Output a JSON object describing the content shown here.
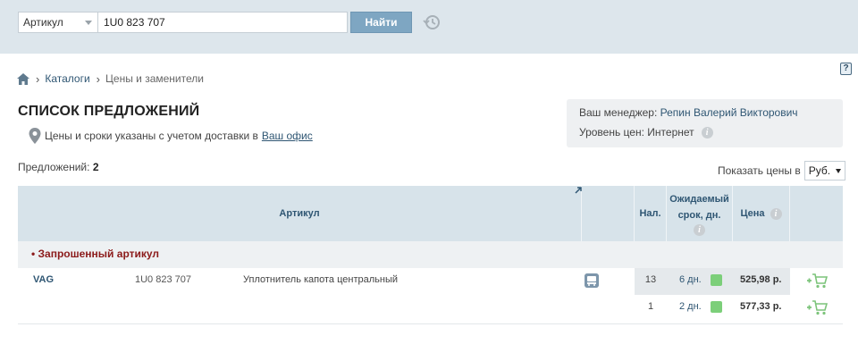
{
  "search": {
    "type_label": "Артикул",
    "query": "1U0 823 707",
    "button_label": "Найти"
  },
  "help": {
    "label": "?"
  },
  "breadcrumb": {
    "items": [
      {
        "label": "Каталоги"
      },
      {
        "label": "Цены и заменители"
      }
    ]
  },
  "page": {
    "title": "СПИСОК ПРЕДЛОЖЕНИЙ",
    "delivery_text": "Цены и сроки указаны с учетом доставки в",
    "delivery_link": "Ваш офис"
  },
  "manager": {
    "label": "Ваш менеджер:",
    "name": "Репин Валерий Викторович",
    "level_label": "Уровень цен:",
    "level_value": "Интернет"
  },
  "offers": {
    "count_label": "Предложений:",
    "count": "2"
  },
  "currency": {
    "label": "Показать цены в",
    "selected": "Руб."
  },
  "table": {
    "columns": {
      "article": "Артикул",
      "stock": "Нал.",
      "term_line1": "Ожидаемый",
      "term_line2": "срок, дн.",
      "price": "Цена"
    },
    "group_label": "• Запрошенный артикул",
    "rows": [
      {
        "brand": "VAG",
        "article": "1U0 823 707",
        "description": "Уплотнитель капота центральный",
        "stock": "13",
        "term": "6 дн.",
        "price": "525,98 р."
      },
      {
        "brand": "",
        "article": "",
        "description": "",
        "stock": "1",
        "term": "2 дн.",
        "price": "577,33 р."
      }
    ]
  },
  "colors": {
    "topbar_bg": "#dde6ec",
    "accent_blue": "#2f5673",
    "button_bg": "#7ea6c2",
    "group_red": "#8b1a1a",
    "availability_green": "#7ccf7a"
  },
  "icons": {
    "history": "history-clock-icon",
    "home": "home-icon",
    "pin": "location-pin-icon",
    "info": "info-icon",
    "bus": "delivery-bus-icon",
    "cart": "add-to-cart-icon"
  }
}
